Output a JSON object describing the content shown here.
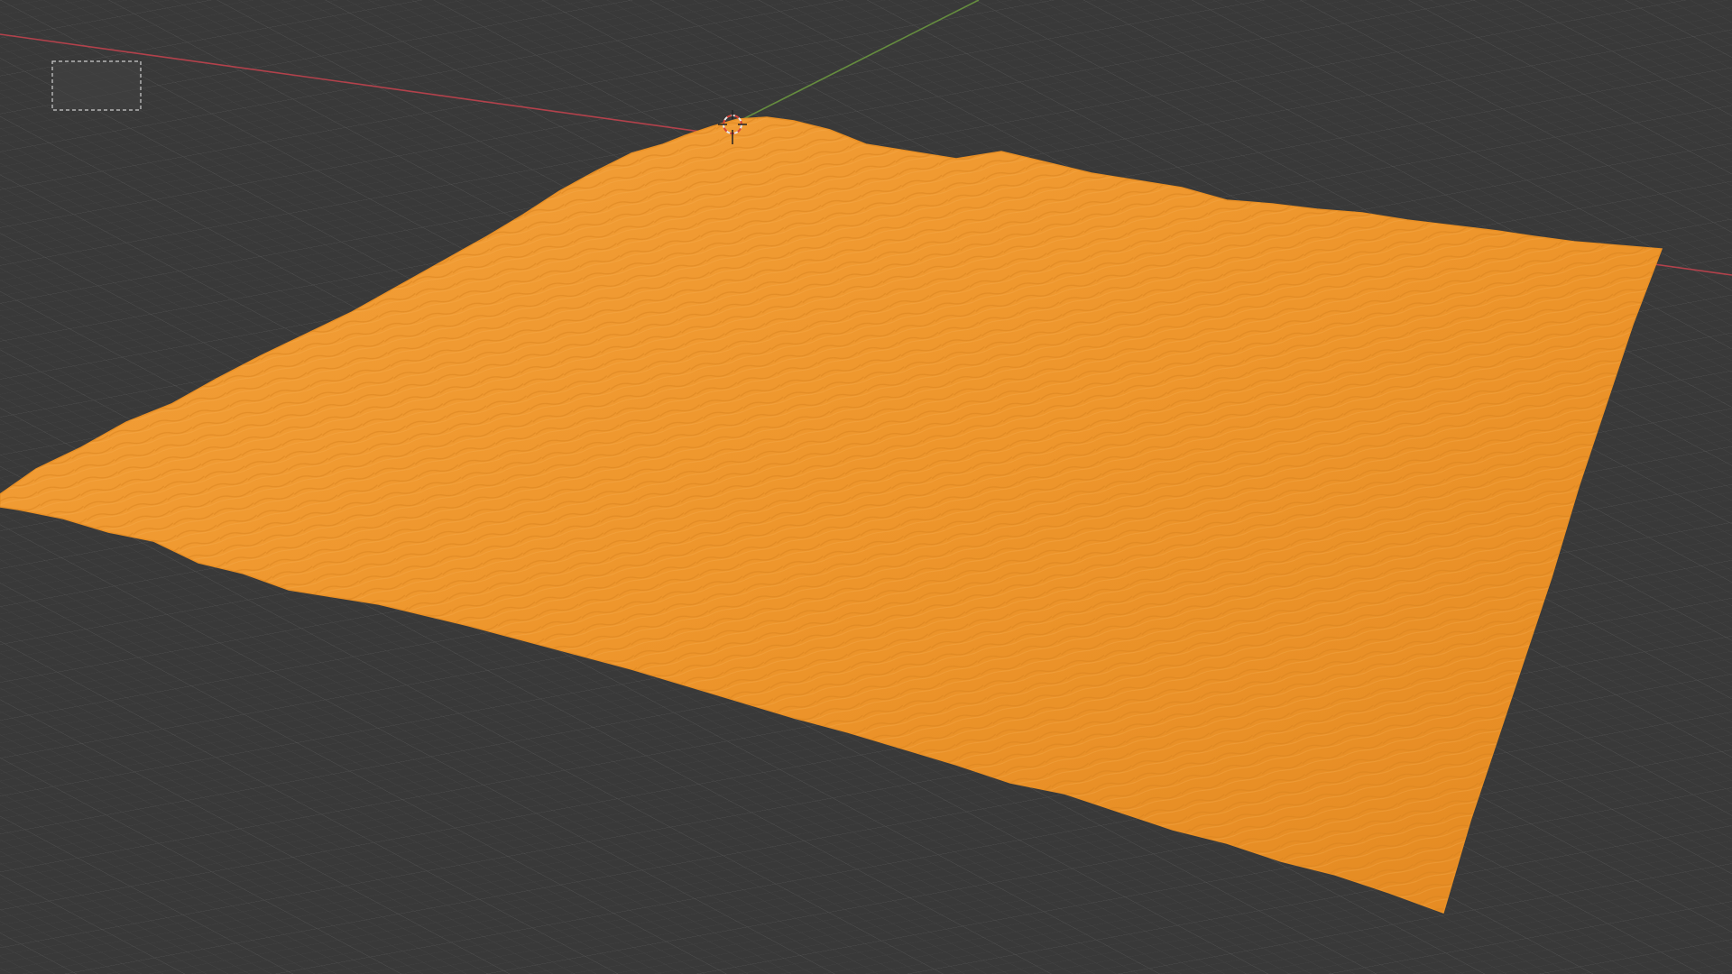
{
  "app": {
    "name": "3D Viewport"
  },
  "viewport": {
    "shading": "solid",
    "background_color": "#393939",
    "grid_color": "#4a4a4a",
    "grid_major_color": "#535353"
  },
  "axes": {
    "x_axis_color": "#c9434f",
    "y_axis_color": "#6d9c3f"
  },
  "scene": {
    "selected_object": "terrain-plane",
    "selected": true,
    "selection_color": "#f0962a"
  },
  "icons": {
    "cursor": "3d-cursor-icon",
    "selection_box": "box-select-rectangle"
  }
}
